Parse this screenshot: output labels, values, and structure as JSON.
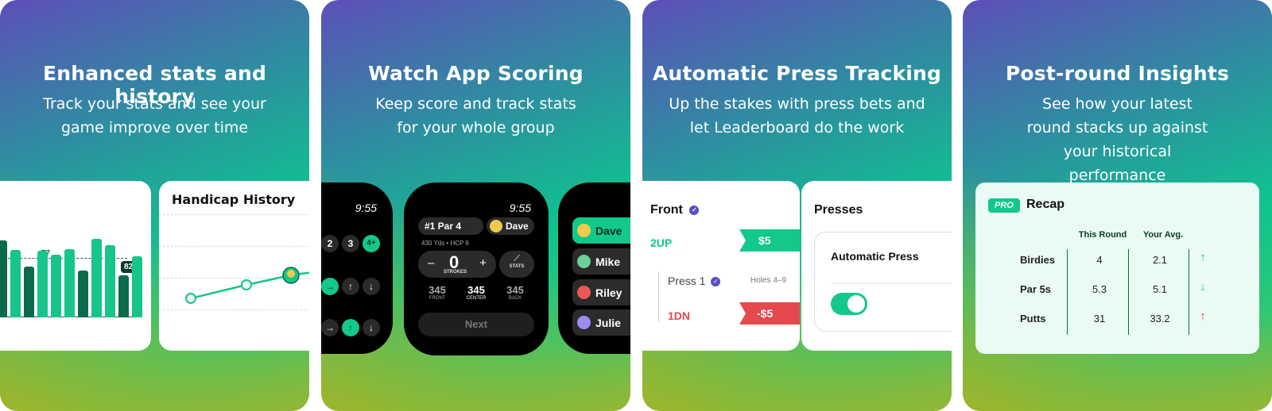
{
  "panels": [
    {
      "headline": "Enhanced stats and history",
      "subline": "Track your stats and see your game improve over time"
    },
    {
      "headline": "Watch App Scoring",
      "subline": "Keep score and track stats for your whole group"
    },
    {
      "headline": "Automatic Press Tracking",
      "subline": "Up the stakes with press bets and let Leaderboard do the work"
    },
    {
      "headline": "Post-round Insights",
      "subline": "See how your latest round stacks up against your historical performance"
    }
  ],
  "stats_card": {
    "bar_label": "77",
    "avg_label": "82.2",
    "bars": [
      {
        "value": 88,
        "dark": true
      },
      {
        "value": 77,
        "dark": false
      },
      {
        "value": 58,
        "dark": true
      },
      {
        "value": 76,
        "dark": false
      },
      {
        "value": 72,
        "dark": false
      },
      {
        "value": 78,
        "dark": false
      },
      {
        "value": 54,
        "dark": true
      },
      {
        "value": 90,
        "dark": false
      },
      {
        "value": 83,
        "dark": false
      },
      {
        "value": 48,
        "dark": true
      },
      {
        "value": 70,
        "dark": false
      }
    ]
  },
  "handicap_card": {
    "title": "Handicap History"
  },
  "watch_left": {
    "time": "9:55",
    "buttons": [
      "2",
      "3",
      "4+"
    ]
  },
  "watch_center": {
    "time": "9:55",
    "hole_label": "#1 Par 4",
    "player": "Dave",
    "yardage": "430 Yds • HCP 6",
    "minus": "–",
    "strokes_value": "0",
    "plus": "+",
    "strokes_label": "STROKES",
    "stats_label": "STATS",
    "distances": [
      {
        "value": "345",
        "label": "FRONT"
      },
      {
        "value": "345",
        "label": "CENTER"
      },
      {
        "value": "345",
        "label": "BACK"
      }
    ],
    "next_label": "Next"
  },
  "watch_right": {
    "players": [
      {
        "name": "Dave",
        "active": true
      },
      {
        "name": "Mike",
        "active": false
      },
      {
        "name": "Riley",
        "active": false
      },
      {
        "name": "Julie",
        "active": false
      }
    ]
  },
  "press_card": {
    "title": "Front",
    "status_up": "2UP",
    "amount_up": "$5",
    "press_title": "Press 1",
    "holes": "Holes 4–9",
    "status_down": "1DN",
    "amount_down": "-$5"
  },
  "presses_card": {
    "title": "Presses",
    "option_label": "Automatic Press"
  },
  "recap_card": {
    "badge": "PRO",
    "title": "Recap",
    "col_this": "This Round",
    "col_avg": "Your Avg.",
    "rows": [
      {
        "label": "Birdies",
        "this": "4",
        "avg": "2.1",
        "trend": "up"
      },
      {
        "label": "Par 5s",
        "this": "5.3",
        "avg": "5.1",
        "trend": "down"
      },
      {
        "label": "Putts",
        "this": "31",
        "avg": "33.2",
        "trend": "up-red"
      }
    ]
  },
  "colors": {
    "accent_green": "#12c98a",
    "dark_green": "#0b6b47",
    "red": "#e5484d",
    "purple": "#5b4fc4"
  }
}
